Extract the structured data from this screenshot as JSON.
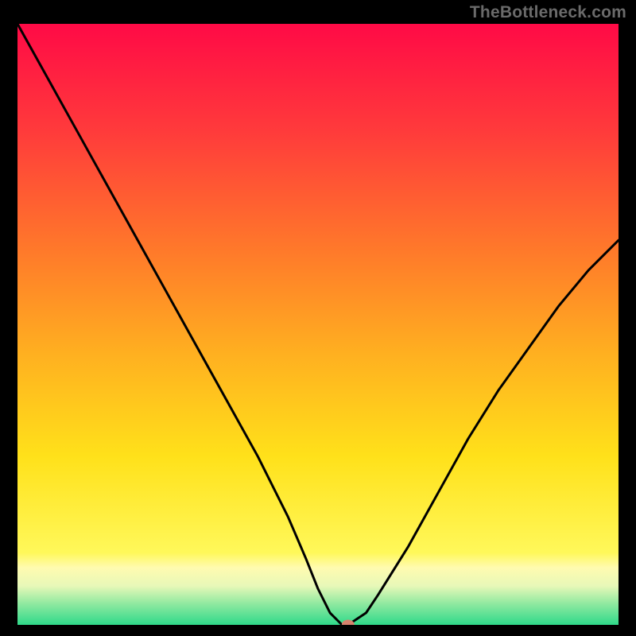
{
  "watermark": "TheBottleneck.com",
  "chart_data": {
    "type": "line",
    "title": "",
    "xlabel": "",
    "ylabel": "",
    "xlim": [
      0,
      100
    ],
    "ylim": [
      0,
      100
    ],
    "series": [
      {
        "name": "curve",
        "x": [
          0,
          5,
          10,
          15,
          20,
          25,
          30,
          35,
          40,
          45,
          48,
          50,
          52,
          54,
          55,
          58,
          60,
          65,
          70,
          75,
          80,
          85,
          90,
          95,
          100
        ],
        "y": [
          100,
          91,
          82,
          73,
          64,
          55,
          46,
          37,
          28,
          18,
          11,
          6,
          2,
          0,
          0,
          2,
          5,
          13,
          22,
          31,
          39,
          46,
          53,
          59,
          64
        ]
      }
    ],
    "marker": {
      "x": 55,
      "y": 0,
      "color": "#d6816d"
    },
    "green_band": {
      "y0": 0,
      "y1": 3
    },
    "yellow_band": {
      "y0": 3,
      "y1": 10
    },
    "gradient_stops": [
      {
        "offset": 0.0,
        "color": "#ff0a46"
      },
      {
        "offset": 0.18,
        "color": "#ff3b3b"
      },
      {
        "offset": 0.38,
        "color": "#ff7a2a"
      },
      {
        "offset": 0.55,
        "color": "#ffb020"
      },
      {
        "offset": 0.72,
        "color": "#ffe11a"
      },
      {
        "offset": 0.88,
        "color": "#fff85a"
      },
      {
        "offset": 0.905,
        "color": "#fffbb0"
      },
      {
        "offset": 0.935,
        "color": "#e8f8b8"
      },
      {
        "offset": 0.965,
        "color": "#8fe9a0"
      },
      {
        "offset": 1.0,
        "color": "#2fd98a"
      }
    ]
  }
}
